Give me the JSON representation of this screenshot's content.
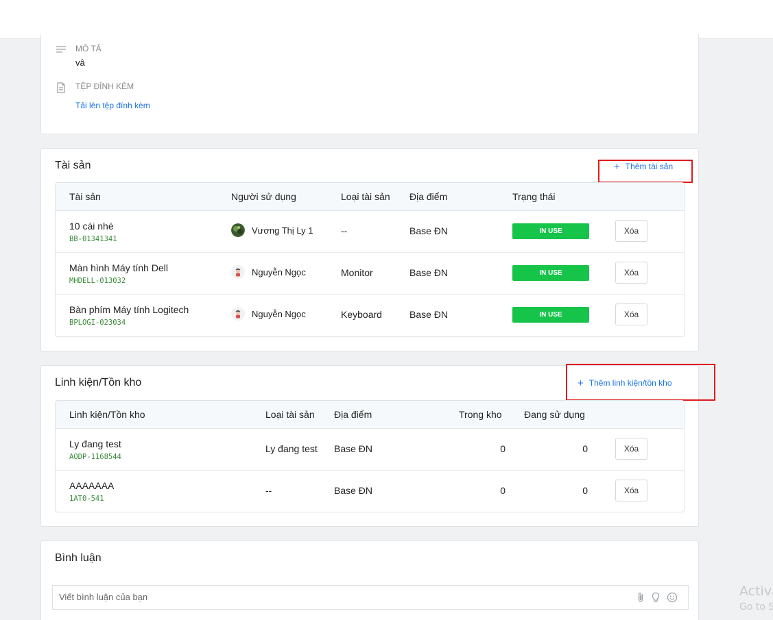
{
  "description": {
    "label": "MÔ TẢ",
    "value": "vâ"
  },
  "attachments": {
    "label": "TỆP ĐÍNH KÈM",
    "upload_link": "Tải lên tệp đính kèm"
  },
  "assets": {
    "title": "Tài sản",
    "add_label": "Thêm tài sản",
    "columns": [
      "Tài sản",
      "Người sử dụng",
      "Loại tài sản",
      "Địa điểm",
      "Trạng thái"
    ],
    "rows": [
      {
        "name": "10 cái nhé",
        "code": "BB-01341341",
        "user": "Vương Thị Ly 1",
        "type": "--",
        "location": "Base ĐN",
        "status": "IN USE",
        "delete": "Xóa"
      },
      {
        "name": "Màn hình Máy tính Dell",
        "code": "MHDELL-013032",
        "user": "Nguyễn Ngọc",
        "type": "Monitor",
        "location": "Base ĐN",
        "status": "IN USE",
        "delete": "Xóa"
      },
      {
        "name": "Bàn phím Máy tính Logitech",
        "code": "BPLOGI-023034",
        "user": "Nguyễn Ngọc",
        "type": "Keyboard",
        "location": "Base ĐN",
        "status": "IN USE",
        "delete": "Xóa"
      }
    ]
  },
  "components": {
    "title": "Linh kiện/Tồn kho",
    "add_label": "Thêm linh kiện/tồn kho",
    "columns": [
      "Linh kiện/Tồn kho",
      "Loại tài sản",
      "Địa điểm",
      "Trong kho",
      "Đang sử dụng"
    ],
    "rows": [
      {
        "name": "Ly đang test",
        "code": "AODP-1168544",
        "type": "Ly đang test",
        "location": "Base ĐN",
        "in_stock": "0",
        "in_use": "0",
        "delete": "Xóa"
      },
      {
        "name": "AAAAAAA",
        "code": "1AT0-541",
        "type": "--",
        "location": "Base ĐN",
        "in_stock": "0",
        "in_use": "0",
        "delete": "Xóa"
      }
    ]
  },
  "comments": {
    "title": "Bình luận",
    "placeholder": "Viết bình luận của bạn"
  },
  "watermark": {
    "line1": "Activa",
    "line2": "Go to S"
  },
  "colors": {
    "accent": "#1a73e8",
    "status_in_use": "#17c44a",
    "highlight": "#e01b1b"
  }
}
